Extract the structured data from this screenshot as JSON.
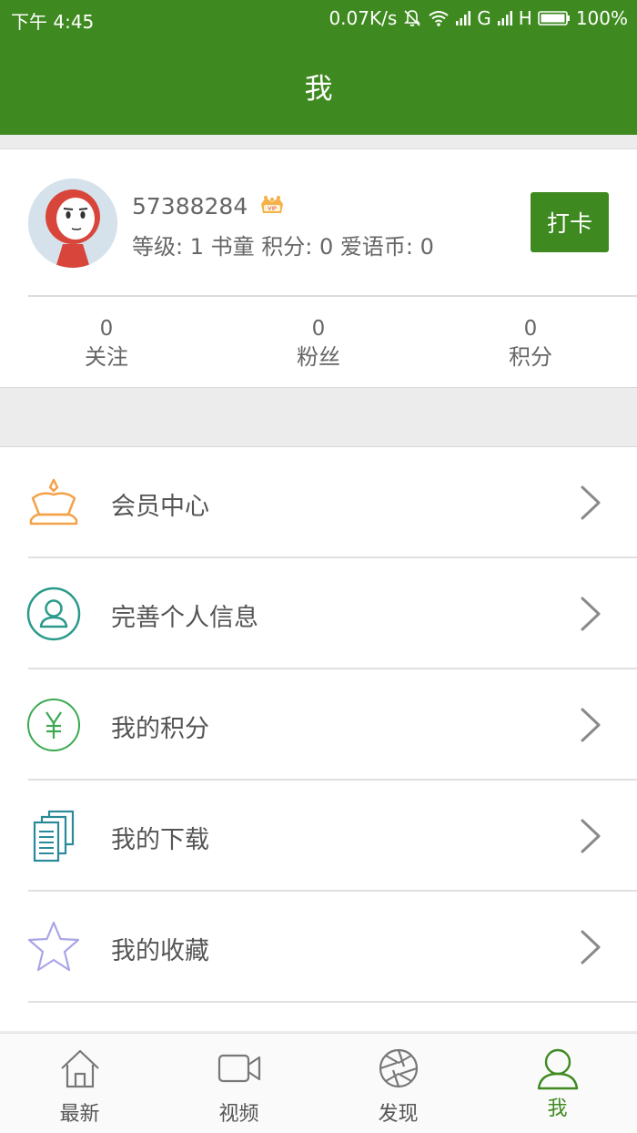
{
  "status_bar": {
    "time": "下午 4:45",
    "network_speed": "0.07K/s",
    "signal_g": "G",
    "signal_h": "H",
    "battery": "100%"
  },
  "header": {
    "title": "我"
  },
  "profile": {
    "username": "57388284",
    "vip_badge": "VIP",
    "info": "等级: 1 书童 积分: 0 爱语币: 0",
    "checkin_label": "打卡",
    "stats": [
      {
        "value": "0",
        "label": "关注"
      },
      {
        "value": "0",
        "label": "粉丝"
      },
      {
        "value": "0",
        "label": "积分"
      }
    ]
  },
  "menu": {
    "items": [
      {
        "label": "会员中心",
        "icon": "crown-icon",
        "color": "#f4a24a"
      },
      {
        "label": "完善个人信息",
        "icon": "user-circle-icon",
        "color": "#2a9a8a"
      },
      {
        "label": "我的积分",
        "icon": "yen-circle-icon",
        "color": "#3aaa50"
      },
      {
        "label": "我的下载",
        "icon": "documents-icon",
        "color": "#2a8a9a"
      },
      {
        "label": "我的收藏",
        "icon": "star-icon",
        "color": "#a9a6e8"
      }
    ]
  },
  "tabbar": {
    "tabs": [
      {
        "label": "最新",
        "icon": "home-icon"
      },
      {
        "label": "视频",
        "icon": "video-camera-icon"
      },
      {
        "label": "发现",
        "icon": "aperture-icon"
      },
      {
        "label": "我",
        "icon": "person-icon",
        "active": true
      }
    ],
    "active_color": "#3f8a20"
  },
  "colors": {
    "primary": "#3f8a20"
  }
}
